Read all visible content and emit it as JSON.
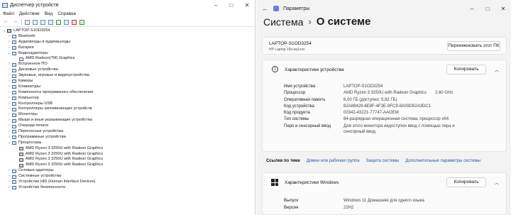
{
  "device_manager": {
    "title": "Диспетчер устройств",
    "menu": [
      "Файл",
      "Действие",
      "Вид",
      "Справка"
    ],
    "tree": [
      {
        "label": "LAPTOP-S1OD3254",
        "level": 0,
        "expanded": true,
        "root": true
      },
      {
        "label": "Bluetooth",
        "level": 1
      },
      {
        "label": "Аудиовходы и аудиовыходы",
        "level": 1
      },
      {
        "label": "Батареи",
        "level": 1
      },
      {
        "label": "Видеоадаптеры",
        "level": 1,
        "expanded": true
      },
      {
        "label": "AMD Radeon(TM) Graphics",
        "level": 2
      },
      {
        "label": "Встроенное ПО",
        "level": 1
      },
      {
        "label": "Дисковые устройства",
        "level": 1
      },
      {
        "label": "Звуковые, игровые и видеоустройства",
        "level": 1
      },
      {
        "label": "Камеры",
        "level": 1
      },
      {
        "label": "Клавиатуры",
        "level": 1
      },
      {
        "label": "Компоненты программного обеспечения",
        "level": 1
      },
      {
        "label": "Компьютер",
        "level": 1
      },
      {
        "label": "Контроллеры USB",
        "level": 1
      },
      {
        "label": "Контроллеры запоминающих устройств",
        "level": 1
      },
      {
        "label": "Мониторы",
        "level": 1
      },
      {
        "label": "Мыши и иные указывающие устройства",
        "level": 1
      },
      {
        "label": "Очереди печати",
        "level": 1
      },
      {
        "label": "Переносные устройства",
        "level": 1
      },
      {
        "label": "Программные устройства",
        "level": 1
      },
      {
        "label": "Процессоры",
        "level": 1,
        "expanded": true
      },
      {
        "label": "AMD Ryzen 3 3250U with Radeon Graphics",
        "level": 2,
        "cpu": true
      },
      {
        "label": "AMD Ryzen 3 3250U with Radeon Graphics",
        "level": 2,
        "cpu": true
      },
      {
        "label": "AMD Ryzen 3 3250U with Radeon Graphics",
        "level": 2,
        "cpu": true
      },
      {
        "label": "AMD Ryzen 3 3250U with Radeon Graphics",
        "level": 2,
        "cpu": true
      },
      {
        "label": "Сетевые адаптеры",
        "level": 1
      },
      {
        "label": "Системные устройства",
        "level": 1
      },
      {
        "label": "Устройства HID (Human Interface Devices)",
        "level": 1
      },
      {
        "label": "Устройства безопасности",
        "level": 1
      }
    ]
  },
  "settings": {
    "title": "Параметры",
    "breadcrumb_parent": "Система",
    "breadcrumb_sep": "›",
    "breadcrumb_current": "О системе",
    "pc_name": "LAPTOP-S1OD3254",
    "pc_model": "HP Laptop 15s-eq1xxx",
    "rename_button": "Переименовать этот ПК",
    "device_specs": {
      "title": "Характеристики устройства",
      "copy_button": "Копировать",
      "rows": [
        {
          "key": "Имя устройства",
          "value": "LAPTOP-S1OD3254"
        },
        {
          "key": "Процессор",
          "value": "AMD Ryzen 3 3250U with Radeon Graphics",
          "value2": "2.60 GHz"
        },
        {
          "key": "Оперативная память",
          "value": "8,00 ГБ (доступно: 5,92 ГБ)"
        },
        {
          "key": "Код устройства",
          "value": "82A89429-6E8F-4F3E-9FC9-8A09D92A3DC1"
        },
        {
          "key": "Код продукта",
          "value": "00342-43221-77747-AAOEM"
        },
        {
          "key": "Тип системы",
          "value": "64-разрядная операционная система, процессор x64"
        },
        {
          "key": "Перо и сенсорный ввод",
          "value": "Для этого монитора недоступен ввод с помощью пера и сенсорный ввод"
        }
      ]
    },
    "related_links": {
      "label": "Ссылки по теме",
      "links": [
        "Домен или рабочая группа",
        "Защита системы",
        "Дополнительные параметры системы"
      ]
    },
    "windows_specs": {
      "title": "Характеристики Windows",
      "copy_button": "Копировать",
      "rows": [
        {
          "key": "Выпуск",
          "value": "Windows 11 Домашняя для одного языка"
        },
        {
          "key": "Версия",
          "value": "22H2"
        }
      ]
    }
  }
}
